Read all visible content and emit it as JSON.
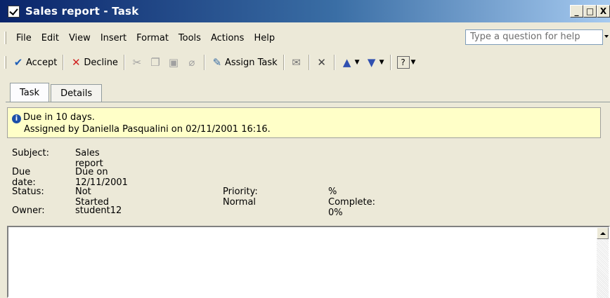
{
  "window": {
    "title": "Sales report - Task"
  },
  "window_buttons": {
    "minimize": "_",
    "maximize": "□",
    "close": "X"
  },
  "menu": {
    "items": [
      {
        "label": "File"
      },
      {
        "label": "Edit"
      },
      {
        "label": "View"
      },
      {
        "label": "Insert"
      },
      {
        "label": "Format"
      },
      {
        "label": "Tools"
      },
      {
        "label": "Actions"
      },
      {
        "label": "Help"
      }
    ],
    "help_placeholder": "Type a question for help"
  },
  "toolbar": {
    "accept_label": "Accept",
    "decline_label": "Decline",
    "assign_label": "Assign Task",
    "icons": [
      "check-icon",
      "x-icon",
      "cut-icon",
      "copy-icon",
      "paste-icon",
      "attach-icon",
      "assign-task-icon",
      "send-status-icon",
      "delete-icon",
      "previous-item-icon",
      "next-item-icon",
      "help-icon"
    ]
  },
  "tabs": [
    {
      "label": "Task"
    },
    {
      "label": "Details"
    }
  ],
  "info": {
    "line1": "Due in 10 days.",
    "line2": "Assigned by Daniella Pasqualini on 02/11/2001 16:16."
  },
  "fields": {
    "subject_label": "Subject:",
    "subject_value": "Sales report",
    "due_label": "Due date:",
    "due_value": "Due on 12/11/2001",
    "status_label": "Status:",
    "status_value": "Not Started",
    "priority": "Priority: Normal",
    "complete": "% Complete: 0%",
    "owner_label": "Owner:",
    "owner_value": "student12"
  },
  "colors": {
    "titlebar": "#0a246a",
    "infobar": "#ffffc8",
    "accept": "#1f5fb8",
    "decline": "#d02020"
  }
}
